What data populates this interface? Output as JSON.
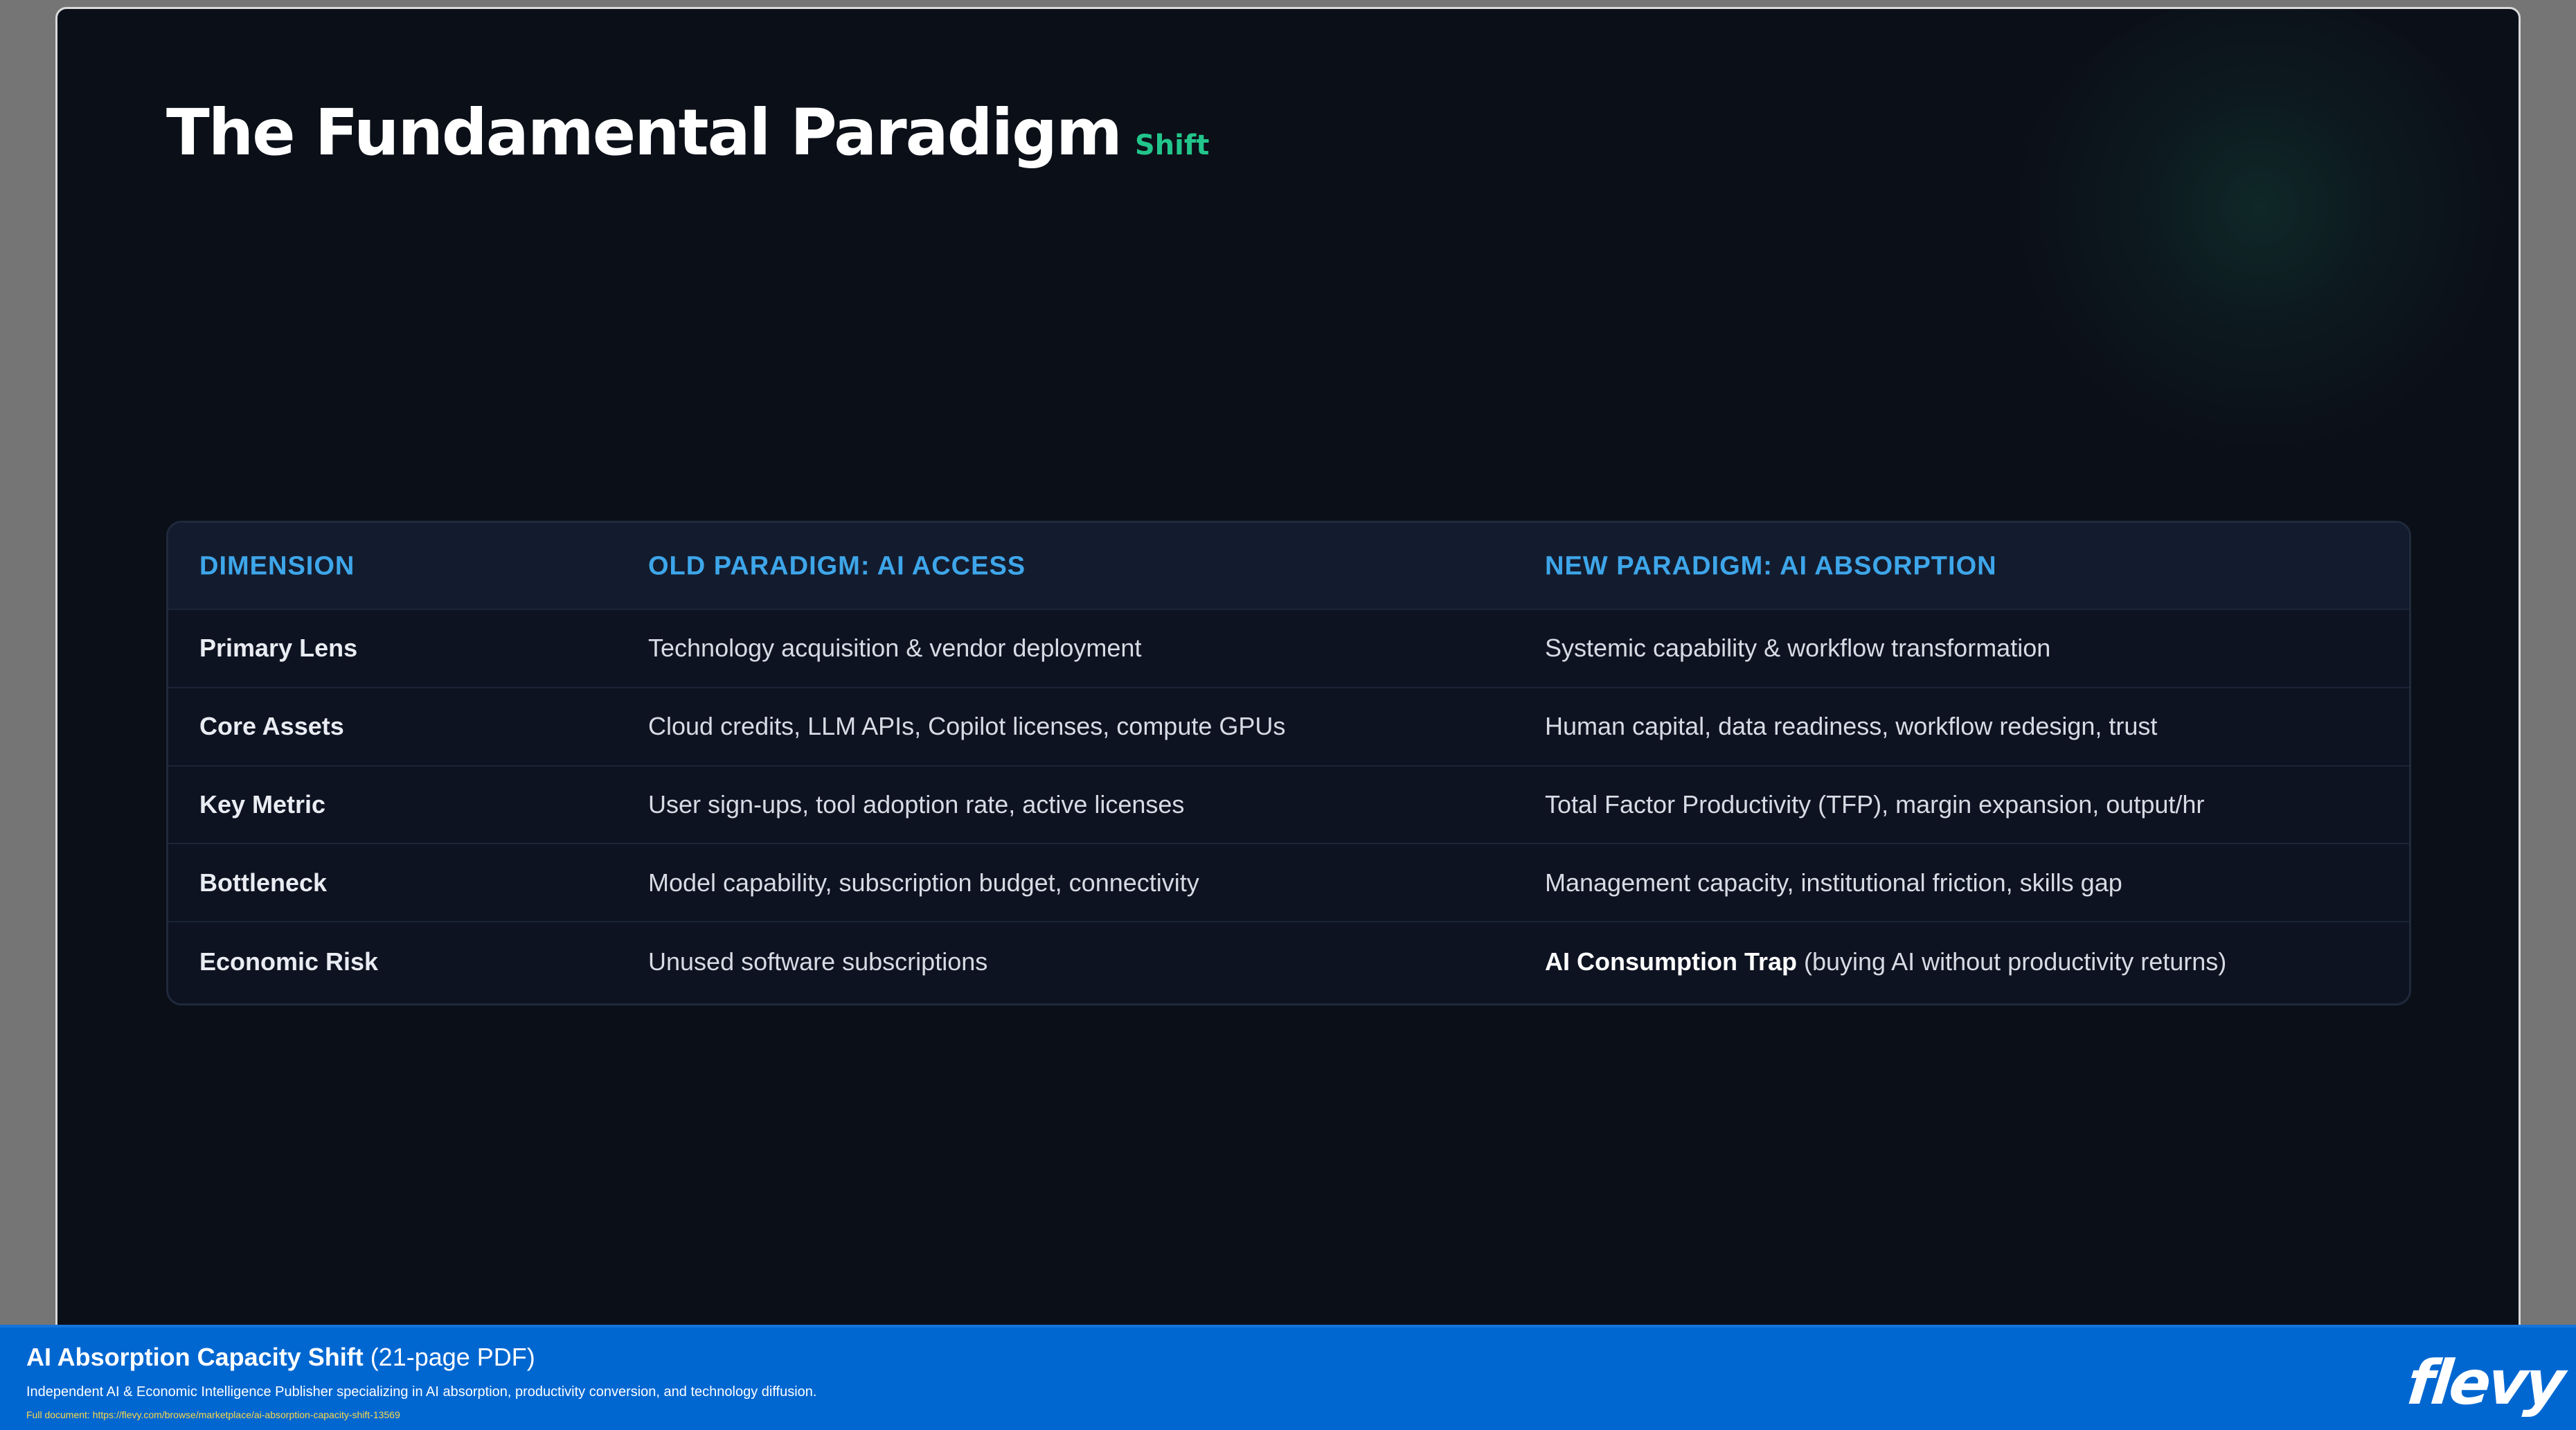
{
  "slide": {
    "title": "The Fundamental Paradigm",
    "title_accent": "Shift"
  },
  "table": {
    "headers": [
      "DIMENSION",
      "OLD PARADIGM: AI ACCESS",
      "NEW PARADIGM: AI ABSORPTION"
    ],
    "rows": [
      {
        "dimension": "Primary Lens",
        "old": "Technology acquisition & vendor deployment",
        "new": "Systemic capability & workflow transformation",
        "new_bold": ""
      },
      {
        "dimension": "Core Assets",
        "old": "Cloud credits, LLM APIs, Copilot licenses, compute GPUs",
        "new": "Human capital, data readiness, workflow redesign, trust",
        "new_bold": ""
      },
      {
        "dimension": "Key Metric",
        "old": "User sign-ups, tool adoption rate, active licenses",
        "new": "Total Factor Productivity (TFP), margin expansion, output/hr",
        "new_bold": ""
      },
      {
        "dimension": "Bottleneck",
        "old": "Model capability, subscription budget, connectivity",
        "new": "Management capacity, institutional friction, skills gap",
        "new_bold": ""
      },
      {
        "dimension": "Economic Risk",
        "old": "Unused software subscriptions",
        "new": " (buying AI without productivity returns)",
        "new_bold": "AI Consumption Trap"
      }
    ]
  },
  "footer": {
    "title_bold": "AI Absorption Capacity Shift",
    "title_rest": " (21-page PDF)",
    "subtitle": "Independent AI & Economic Intelligence Publisher specializing in AI absorption, productivity conversion, and technology diffusion.",
    "link": "Full document: https://flevy.com/browse/marketplace/ai-absorption-capacity-shift-13569",
    "logo": "flevy"
  },
  "colors": {
    "background": "#0b0f18",
    "accent_green": "#22c58b",
    "header_blue": "#3ea6ea",
    "footer_blue": "#0067d1"
  }
}
